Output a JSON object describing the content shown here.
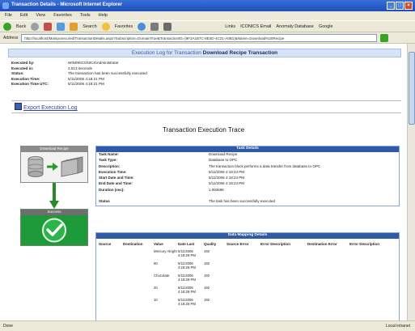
{
  "window": {
    "title": "Transaction Details - Microsoft Internet Explorer"
  },
  "menu": [
    "File",
    "Edit",
    "View",
    "Favorites",
    "Tools",
    "Help"
  ],
  "toolbar": {
    "back": "Back",
    "search": "Search",
    "favorites": "Favorites",
    "links": "Links",
    "link1": "ICONICS Email",
    "link2": "Anomaly Database",
    "link3": "Google"
  },
  "address": {
    "label": "Address",
    "url": "http://localhost/Mainpcsecured/TransactionDetails.aspx?Subscription=DomainTrue&TransactionID={9F2A1B7C-8E4D-4C21-A0B1}&Name=Download%20Recipe"
  },
  "page": {
    "banner_prefix": "Execution Log for Transaction",
    "banner_name": "Download Recipe Transaction",
    "info": [
      {
        "k": "Executed by:",
        "v": "WIN09\\ICONICS\\Administrator"
      },
      {
        "k": "Executed in:",
        "v": "2.513 seconds"
      },
      {
        "k": "Status:",
        "v": "The transaction has been successfully executed"
      },
      {
        "k": "Execution Time:",
        "v": "5/11/2006 4:18:21 PM"
      },
      {
        "k": "Execution Time UTC:",
        "v": "5/11/2006 4:18:21 PM"
      }
    ],
    "export_link": "Export Execution Log",
    "trace_title": "Transaction Execution Trace",
    "steps": [
      {
        "caption": "Download Recipe"
      },
      {
        "caption": "Success"
      }
    ]
  },
  "task": {
    "header": "Task Details",
    "rows": [
      {
        "k": "Task Name:",
        "v": "Download Recipe"
      },
      {
        "k": "Task Type:",
        "v": "Database to OPC"
      },
      {
        "k": "Description:",
        "v": "The transaction block performs a data transfer from database to OPC"
      },
      {
        "k": "Execution Time:",
        "v": "5/11/2006 4:18:24 PM"
      },
      {
        "k": "Start Date and Time:",
        "v": "5/11/2006 4:18:24 PM"
      },
      {
        "k": "End Date and Time:",
        "v": "5/11/2006 4:18:24 PM"
      },
      {
        "k": "Duration (sec):",
        "v": "1.093696"
      },
      {
        "k": "",
        "v": ""
      },
      {
        "k": "Status",
        "v": "The task has been successfully executed"
      }
    ]
  },
  "mapping": {
    "header": "Data Mapping Details",
    "columns": [
      "Source",
      "Destination",
      "Value",
      "Date Last",
      "Quality",
      "Source Error",
      "Error Description",
      "Destination Error",
      "Error Description"
    ],
    "rows": [
      {
        "value": "Mercury Alright",
        "date": "5/11/2006 4:18:28 PM",
        "quality": "192"
      },
      {
        "value": "60",
        "date": "5/11/2006 4:18:28 PM",
        "quality": "192"
      },
      {
        "value": "Chocolate",
        "date": "5/11/2006 4:18:28 PM",
        "quality": "192"
      },
      {
        "value": "20",
        "date": "5/11/2006 4:18:28 PM",
        "quality": "192"
      },
      {
        "value": "10",
        "date": "5/11/2006 4:18:28 PM",
        "quality": "192"
      }
    ]
  },
  "status": {
    "left": "Done",
    "zone": "Local intranet"
  },
  "colors": {
    "accent": "#2f5aa8",
    "banner_bg": "#d6e4f7",
    "chrome": "#ece9d8"
  }
}
